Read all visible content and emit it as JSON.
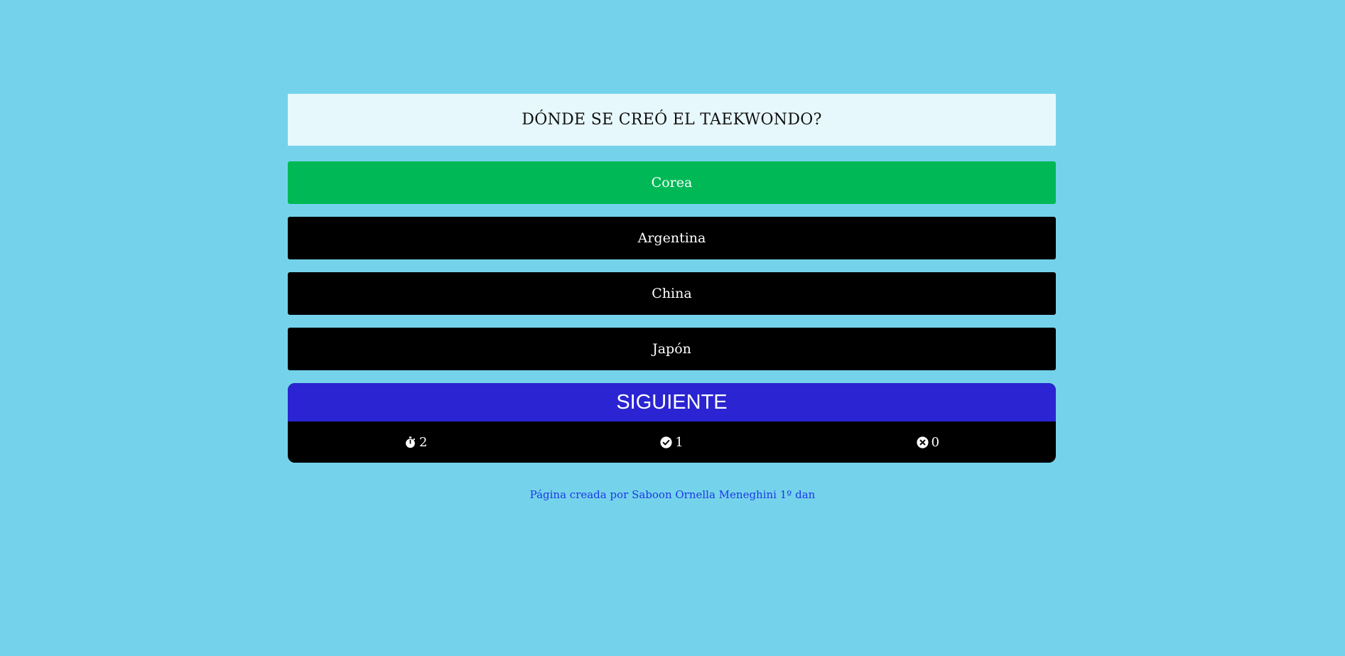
{
  "question": {
    "text": "DÓNDE SE CREÓ EL TAEKWONDO?"
  },
  "answers": [
    {
      "label": "Corea",
      "state": "correct"
    },
    {
      "label": "Argentina",
      "state": "neutral"
    },
    {
      "label": "China",
      "state": "neutral"
    },
    {
      "label": "Japón",
      "state": "neutral"
    }
  ],
  "controls": {
    "next_label": "SIGUIENTE"
  },
  "stats": {
    "timer_icon": "stopwatch-icon",
    "timer_value": "2",
    "correct_icon": "check-circle-icon",
    "correct_value": "1",
    "wrong_icon": "x-circle-icon",
    "wrong_value": "0"
  },
  "footer": {
    "text": "Página creada por Saboon Ornella Meneghini 1º dan"
  },
  "colors": {
    "background": "#74d3eb",
    "question_bg": "#e7f8fc",
    "correct": "#00b956",
    "answer_default": "#000000",
    "next_button": "#2a24d2",
    "footer_text": "#1a39e6"
  }
}
